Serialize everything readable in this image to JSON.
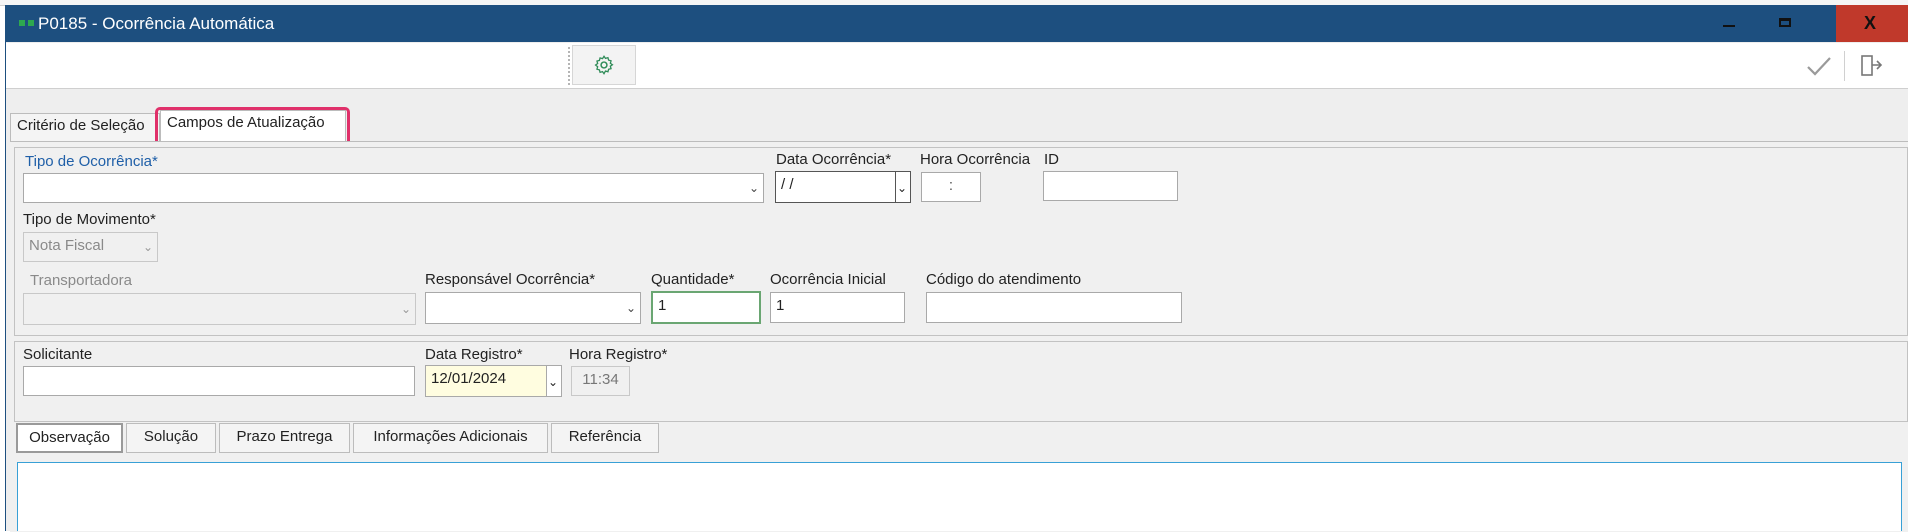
{
  "window": {
    "title": "P0185 - Ocorrência Automática",
    "minimize": "—",
    "maximize": "▭",
    "close": "X"
  },
  "tabs": [
    "Critério de Seleção",
    "Campos de Atualização"
  ],
  "form": {
    "tipo_ocorrencia": {
      "label": "Tipo de Ocorrência*",
      "value": ""
    },
    "data_ocorrencia": {
      "label": "Data Ocorrência*",
      "value": " / /"
    },
    "hora_ocorrencia": {
      "label": "Hora Ocorrência",
      "value": ":"
    },
    "id": {
      "label": "ID",
      "value": ""
    },
    "tipo_movimento": {
      "label": "Tipo de Movimento*",
      "value": "Nota Fiscal"
    },
    "transportadora": {
      "label": "Transportadora",
      "value": ""
    },
    "responsavel": {
      "label": "Responsável Ocorrência*",
      "value": ""
    },
    "quantidade": {
      "label": "Quantidade*",
      "value": "1"
    },
    "ocorrencia_inicial": {
      "label": "Ocorrência Inicial",
      "value": "1"
    },
    "codigo_atendimento": {
      "label": "Código do atendimento",
      "value": ""
    },
    "solicitante": {
      "label": "Solicitante",
      "value": ""
    },
    "data_registro": {
      "label": "Data Registro*",
      "value": "12/01/2024"
    },
    "hora_registro": {
      "label": "Hora Registro*",
      "value": "11:34"
    }
  },
  "bottom_tabs": [
    "Observação",
    "Solução",
    "Prazo Entrega",
    "Informações Adicionais",
    "Referência"
  ],
  "colors": {
    "titlebar": "#1d4f7f",
    "close": "#c0392b",
    "highlight": "#e0306a",
    "accent_blue": "#1f5fa8"
  },
  "icons": [
    "settings-icon",
    "confirm-check-icon",
    "exit-icon"
  ]
}
